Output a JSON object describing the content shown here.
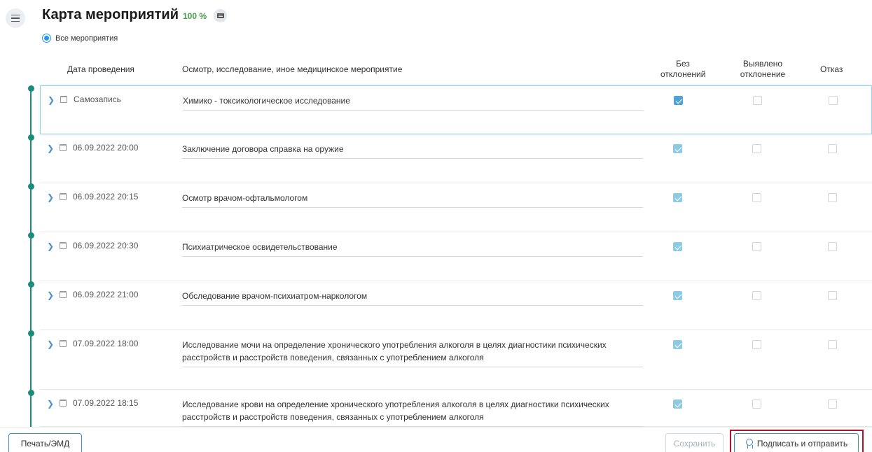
{
  "header": {
    "title": "Карта мероприятий",
    "progress": "100 %"
  },
  "filter": {
    "label": "Все мероприятия"
  },
  "table": {
    "columns": {
      "date": "Дата проведения",
      "event": "Осмотр, исследование, иное медицинское мероприятие",
      "no_deviation": "Без отклонений",
      "deviation": "Выявлено отклонение",
      "refusal": "Отказ"
    },
    "rows": [
      {
        "date": "Самозапись",
        "event": "Химико - токсикологическое исследование",
        "no_deviation": true,
        "deviation": false,
        "refusal": false
      },
      {
        "date": "06.09.2022 20:00",
        "event": "Заключение договора справка на оружие",
        "no_deviation": true,
        "deviation": false,
        "refusal": false
      },
      {
        "date": "06.09.2022 20:15",
        "event": "Осмотр врачом-офтальмологом",
        "no_deviation": true,
        "deviation": false,
        "refusal": false
      },
      {
        "date": "06.09.2022 20:30",
        "event": "Психиатрическое освидетельствование",
        "no_deviation": true,
        "deviation": false,
        "refusal": false
      },
      {
        "date": "06.09.2022 21:00",
        "event": "Обследование врачом-психиатром-наркологом",
        "no_deviation": true,
        "deviation": false,
        "refusal": false
      },
      {
        "date": "07.09.2022 18:00",
        "event": "Исследование мочи на определение хронического употребления алкоголя в целях диагностики психических расстройств и расстройств поведения, связанных с употреблением алкоголя",
        "no_deviation": true,
        "deviation": false,
        "refusal": false
      },
      {
        "date": "07.09.2022 18:15",
        "event": "Исследование крови на определение хронического употребления алкоголя в целях диагностики психических расстройств и расстройств поведения, связанных с употреблением алкоголя",
        "no_deviation": true,
        "deviation": false,
        "refusal": false
      }
    ]
  },
  "footer": {
    "print_label": "Печать/ЭМД",
    "save_label": "Сохранить",
    "sign_label": "Подписать и отправить"
  },
  "colors": {
    "accent": "#3f8cc6",
    "timeline": "#1a8c7e",
    "progress": "#43a047",
    "highlight": "#b3122a"
  }
}
